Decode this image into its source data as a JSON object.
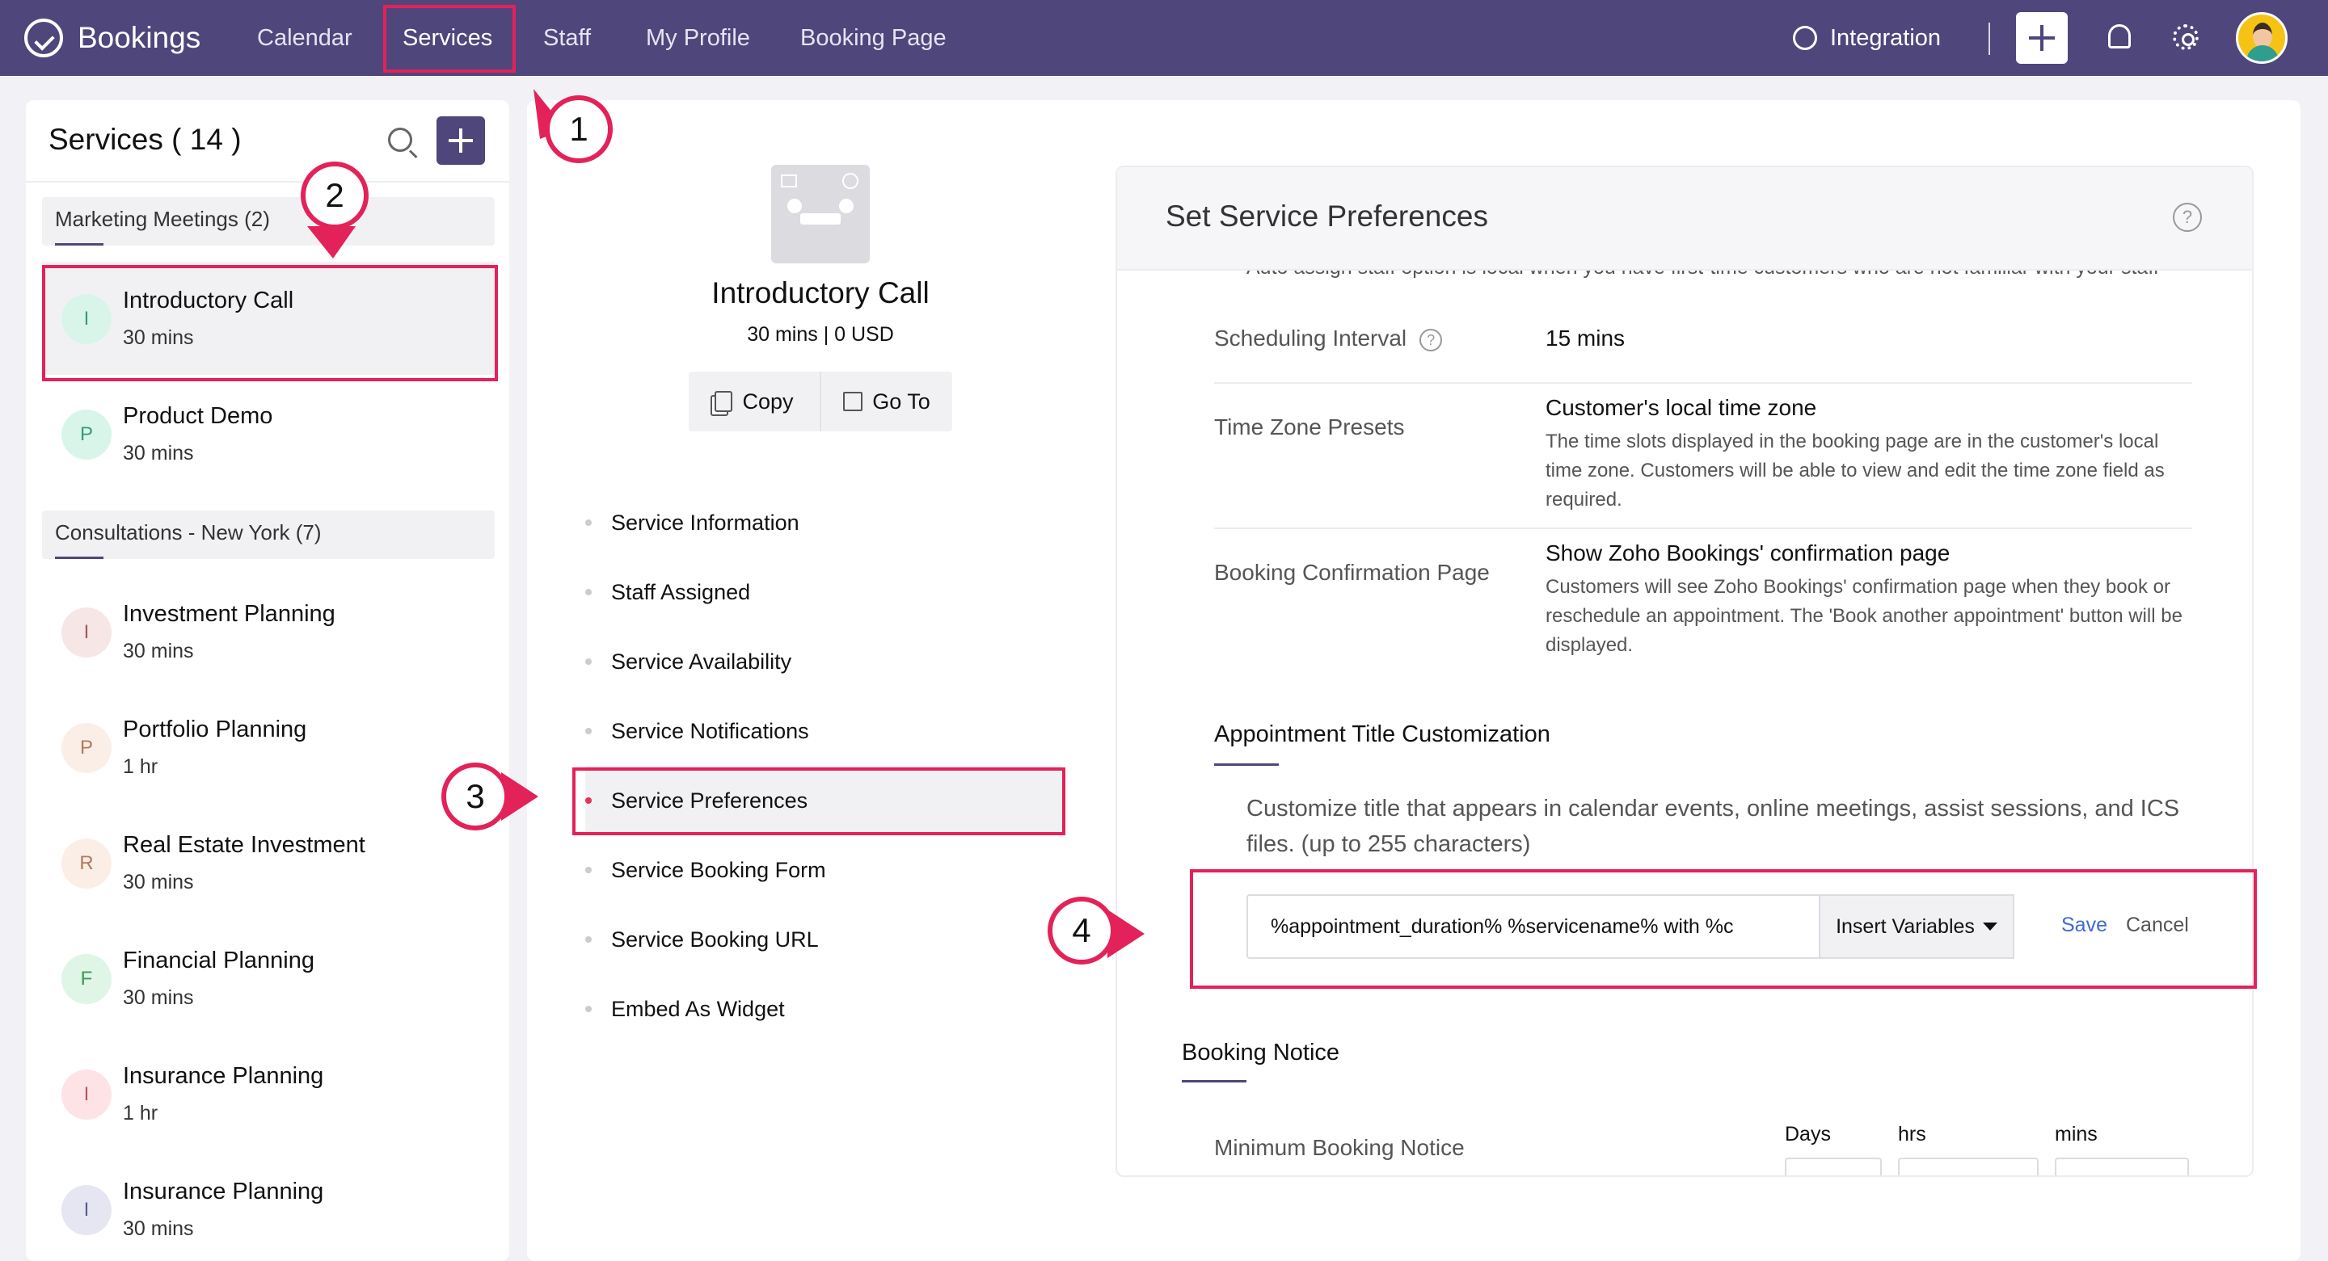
{
  "app": {
    "name": "Bookings",
    "nav": [
      "Calendar",
      "Services",
      "Staff",
      "My Profile",
      "Booking Page"
    ],
    "active_nav": "Services",
    "integration_label": "Integration"
  },
  "sidebar": {
    "title": "Services ( 14 )",
    "groups": [
      {
        "label": "Marketing Meetings (2)"
      },
      {
        "label": "Consultations - New York (7)"
      }
    ],
    "items": [
      {
        "initial": "I",
        "name": "Introductory Call",
        "duration": "30 mins",
        "color": "#d9f5ea",
        "text_color": "#3a9a74",
        "selected": true
      },
      {
        "initial": "P",
        "name": "Product Demo",
        "duration": "30 mins",
        "color": "#d9f5ea",
        "text_color": "#3a9a74"
      },
      {
        "initial": "I",
        "name": "Investment Planning",
        "duration": "30 mins",
        "color": "#f6e6e6",
        "text_color": "#a05a5a"
      },
      {
        "initial": "P",
        "name": "Portfolio Planning",
        "duration": "1 hr",
        "color": "#fbeee6",
        "text_color": "#b07a5a"
      },
      {
        "initial": "R",
        "name": "Real Estate Investment",
        "duration": "30 mins",
        "color": "#fbeee6",
        "text_color": "#b07a5a"
      },
      {
        "initial": "F",
        "name": "Financial Planning",
        "duration": "30 mins",
        "color": "#dff5e6",
        "text_color": "#3a9a5a"
      },
      {
        "initial": "I",
        "name": "Insurance Planning",
        "duration": "1 hr",
        "color": "#fde3e6",
        "text_color": "#c05060"
      },
      {
        "initial": "I",
        "name": "Insurance Planning",
        "duration": "30 mins",
        "color": "#e6e6f2",
        "text_color": "#5a5a8a"
      }
    ]
  },
  "service": {
    "title": "Introductory Call",
    "subtitle": "30 mins | 0 USD",
    "copy_label": "Copy",
    "goto_label": "Go To",
    "menu": [
      "Service Information",
      "Staff Assigned",
      "Service Availability",
      "Service Notifications",
      "Service Preferences",
      "Service Booking Form",
      "Service Booking URL",
      "Embed As Widget"
    ],
    "active_menu": "Service Preferences"
  },
  "preferences": {
    "title": "Set Service Preferences",
    "help": "?",
    "truncated_text": "Auto assign staff option is local when you have first-time customers who are not familiar with your staff",
    "scheduling_interval": {
      "label": "Scheduling Interval",
      "value": "15 mins"
    },
    "time_zone": {
      "label": "Time Zone Presets",
      "value": "Customer's local time zone",
      "desc": "The time slots displayed in the booking page are in the customer's local time zone. Customers will be able to view and edit the time zone field as required."
    },
    "confirmation": {
      "label": "Booking Confirmation Page",
      "value": "Show Zoho Bookings' confirmation page",
      "desc": "Customers will see Zoho Bookings' confirmation page when they book or reschedule an appointment. The 'Book another appointment' button will be displayed."
    },
    "title_custom": {
      "heading": "Appointment Title Customization",
      "desc": "Customize title that appears in calendar events, online meetings, assist sessions, and ICS files. (up to 255 characters)",
      "input_value": "%appointment_duration%  %servicename% with  %c",
      "insert_label": "Insert Variables",
      "save_label": "Save",
      "cancel_label": "Cancel"
    },
    "booking_notice": {
      "heading": "Booking Notice",
      "min_label": "Minimum Booking Notice",
      "units": [
        "Days",
        "hrs",
        "mins"
      ]
    }
  },
  "callouts": [
    "1",
    "2",
    "3",
    "4"
  ],
  "colors": {
    "nav_bg": "#4f467b",
    "highlight": "#e3225a",
    "link": "#3d6ad6"
  }
}
